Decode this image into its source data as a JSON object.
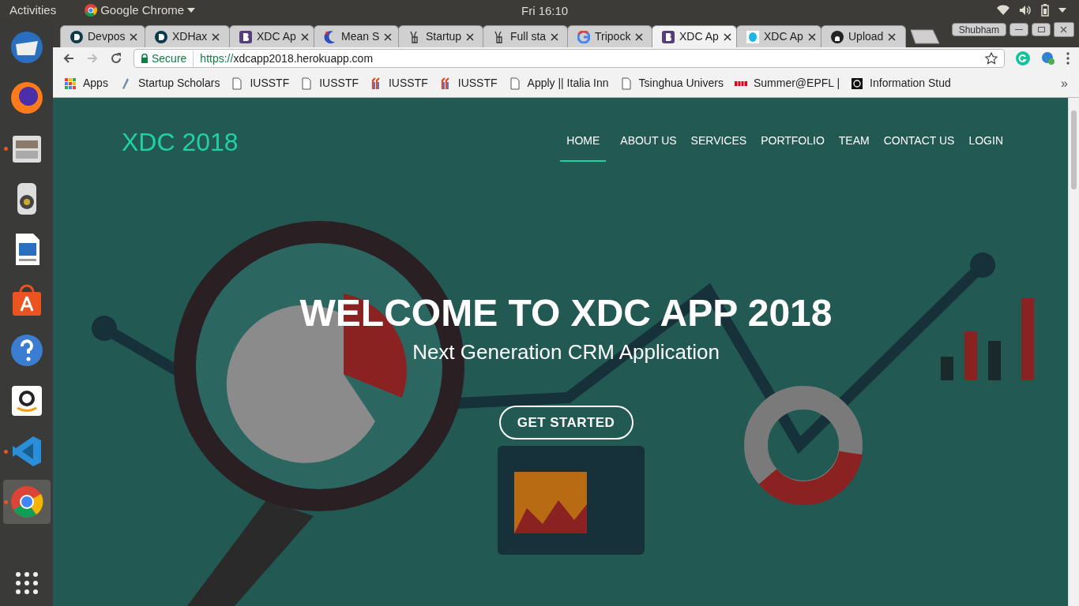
{
  "top_bar": {
    "activities": "Activities",
    "app_menu": "Google Chrome",
    "clock": "Fri 16:10"
  },
  "dock": [
    {
      "kind": "mail",
      "running": false,
      "selected": false
    },
    {
      "kind": "firefox",
      "running": false,
      "selected": false
    },
    {
      "kind": "files",
      "running": true,
      "selected": false
    },
    {
      "kind": "speaker",
      "running": false,
      "selected": false
    },
    {
      "kind": "writer",
      "running": false,
      "selected": false
    },
    {
      "kind": "store",
      "running": false,
      "selected": false
    },
    {
      "kind": "help",
      "running": false,
      "selected": false
    },
    {
      "kind": "amazon",
      "running": false,
      "selected": false
    },
    {
      "kind": "code",
      "running": true,
      "selected": false
    },
    {
      "kind": "chrome",
      "running": true,
      "selected": true
    }
  ],
  "tabs": [
    {
      "title": "Devpos",
      "selected": false
    },
    {
      "title": "XDHax",
      "selected": false
    },
    {
      "title": "XDC Ap",
      "selected": false
    },
    {
      "title": "Mean S",
      "selected": false
    },
    {
      "title": "Startup",
      "selected": false
    },
    {
      "title": "Full sta",
      "selected": false
    },
    {
      "title": "Tripock",
      "selected": false
    },
    {
      "title": "XDC Ap",
      "selected": true
    },
    {
      "title": "XDC Ap",
      "selected": false
    },
    {
      "title": "Upload",
      "selected": false
    }
  ],
  "profile": "Shubham",
  "toolbar": {
    "secure_label": "Secure",
    "url_scheme": "https://",
    "url_host": "xdcapp2018.herokuapp.com"
  },
  "bookmarks": [
    {
      "label": "Apps"
    },
    {
      "label": "Startup Scholars"
    },
    {
      "label": "IUSSTF"
    },
    {
      "label": "IUSSTF"
    },
    {
      "label": "IUSSTF"
    },
    {
      "label": "IUSSTF"
    },
    {
      "label": "Apply || Italia Inn"
    },
    {
      "label": "Tsinghua Univers"
    },
    {
      "label": "Summer@EPFL |"
    },
    {
      "label": "Information Stud"
    }
  ],
  "bookmarks_more": "»",
  "page": {
    "logo": "XDC 2018",
    "nav": [
      {
        "label": "HOME",
        "selected": true
      },
      {
        "label": "ABOUT US",
        "selected": false
      },
      {
        "label": "SERVICES",
        "selected": false
      },
      {
        "label": "PORTFOLIO",
        "selected": false
      },
      {
        "label": "TEAM",
        "selected": false
      },
      {
        "label": "CONTACT US",
        "selected": false
      },
      {
        "label": "LOGIN",
        "selected": false
      }
    ],
    "title": "WELCOME TO XDC APP 2018",
    "subtitle": "Next Generation CRM Application",
    "button": "GET STARTED"
  }
}
